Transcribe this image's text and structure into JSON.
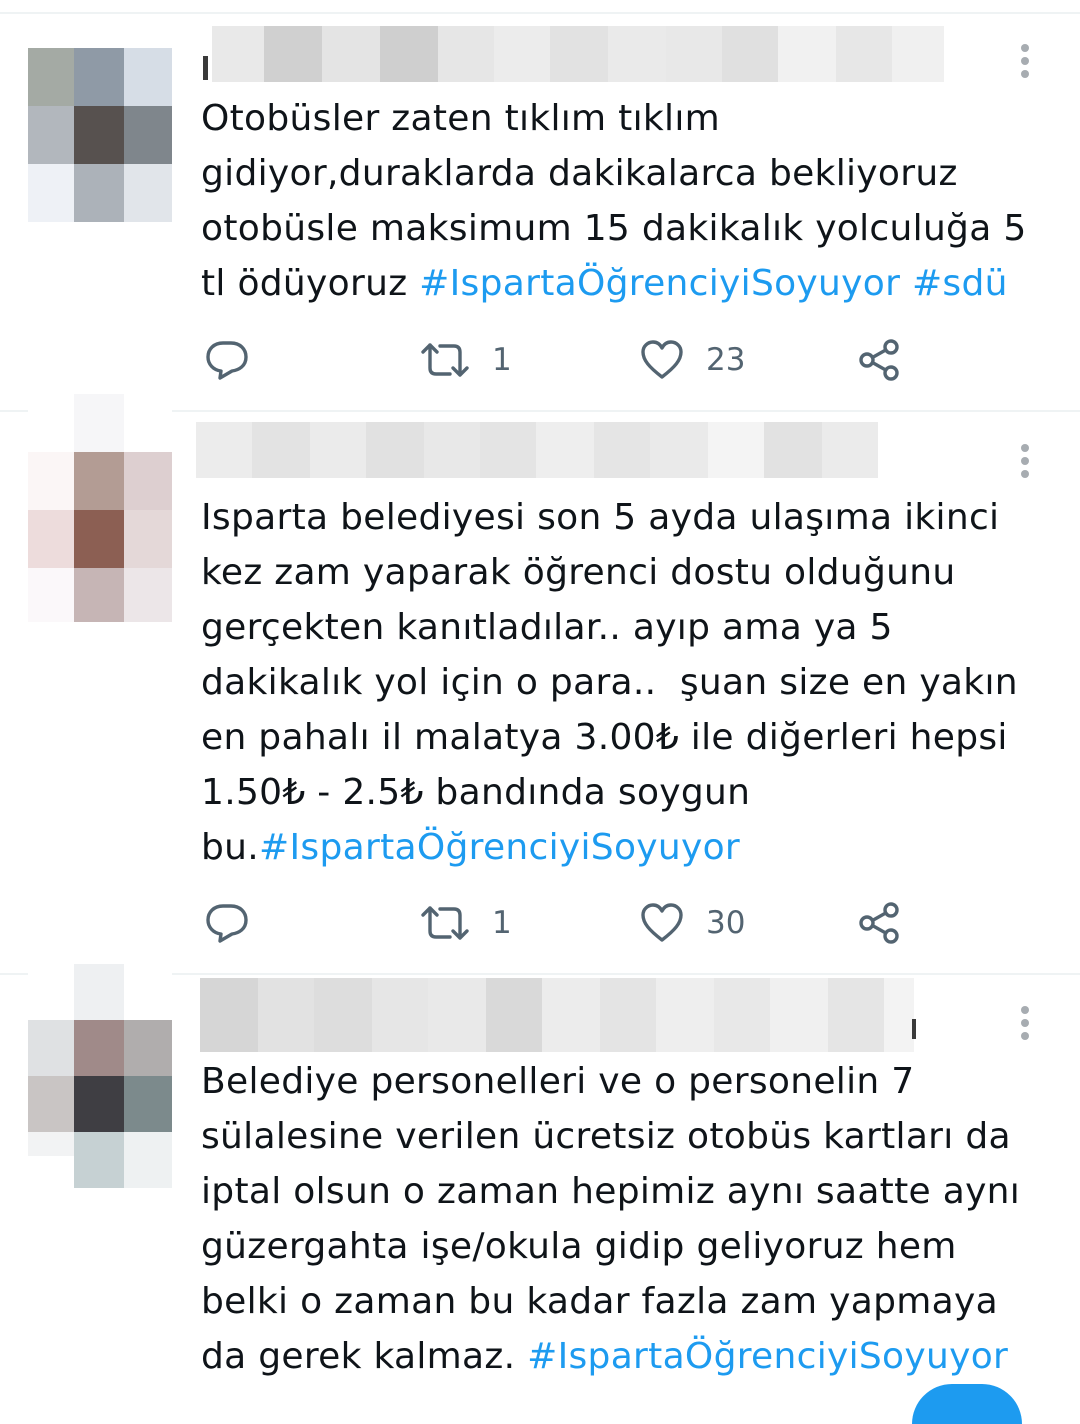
{
  "tweets": [
    {
      "lines": [
        {
          "text": "Otobüsler zaten tıklım tıklım",
          "tags": []
        },
        {
          "text": "gidiyor,duraklarda dakikalarca bekliyoruz",
          "tags": []
        },
        {
          "text": "otobüsle maksimum 15 dakikalık yolculuğa 5",
          "tags": []
        },
        {
          "text": "tl ödüyoruz ",
          "tags": [
            "#IspartaÖğrenciyiSoyuyor",
            " ",
            "#sdü"
          ]
        }
      ],
      "retweets": "1",
      "likes": "23"
    },
    {
      "lines": [
        {
          "text": "Isparta belediyesi son 5 ayda ulaşıma ikinci",
          "tags": []
        },
        {
          "text": "kez zam yaparak öğrenci dostu olduğunu",
          "tags": []
        },
        {
          "text": "gerçekten kanıtladılar.. ayıp ama ya 5",
          "tags": []
        },
        {
          "text": "dakikalık yol için o para..  şuan size en yakın",
          "tags": []
        },
        {
          "text": "en pahalı il malatya 3.00₺ ile diğerleri hepsi",
          "tags": []
        },
        {
          "text": "1.50₺ - 2.5₺ bandında soygun",
          "tags": []
        },
        {
          "text": "bu.",
          "tags": [
            "#IspartaÖğrenciyiSoyuyor"
          ]
        }
      ],
      "retweets": "1",
      "likes": "30"
    },
    {
      "lines": [
        {
          "text": "Belediye personelleri ve o personelin 7",
          "tags": []
        },
        {
          "text": "sülalesine verilen ücretsiz otobüs kartları da",
          "tags": []
        },
        {
          "text": "iptal olsun o zaman hepimiz aynı saatte aynı",
          "tags": []
        },
        {
          "text": "güzergahta işe/okula gidip geliyoruz hem",
          "tags": []
        },
        {
          "text": "belki o zaman bu kadar fazla zam yapmaya",
          "tags": []
        },
        {
          "text": "da gerek kalmaz. ",
          "tags": [
            "#IspartaÖğrenciyiSoyuyor"
          ]
        }
      ]
    }
  ],
  "icons": {
    "reply": "reply-icon",
    "retweet": "retweet-icon",
    "like": "heart-icon",
    "share": "share-icon",
    "more": "more-options-icon"
  },
  "colors": {
    "hashtag": "#1d9bf0",
    "count": "#536471",
    "divider": "#eff3f4"
  }
}
